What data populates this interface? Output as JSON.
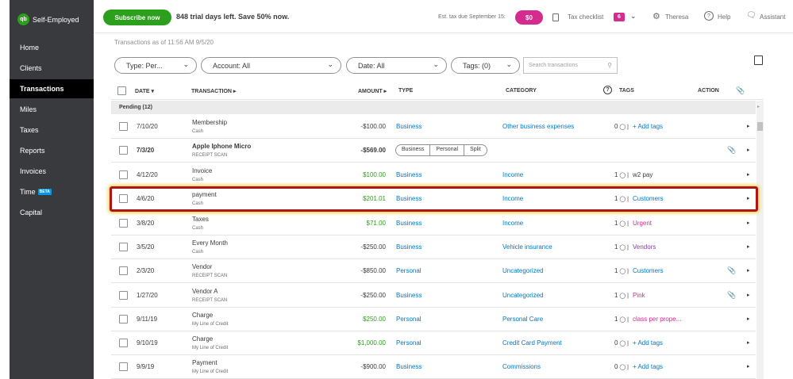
{
  "app": {
    "logo": "qb",
    "name": "Self-Employed"
  },
  "nav": [
    {
      "label": "Home"
    },
    {
      "label": "Clients"
    },
    {
      "label": "Transactions"
    },
    {
      "label": "Miles"
    },
    {
      "label": "Taxes"
    },
    {
      "label": "Reports"
    },
    {
      "label": "Invoices"
    },
    {
      "label": "Time",
      "badge": "BETA"
    },
    {
      "label": "Capital"
    }
  ],
  "topbar": {
    "subscribe": "Subscribe now",
    "trial": "848 trial days left. Save 50% now.",
    "est_tax": "Est. tax due September 15:",
    "tax_amount": "$0",
    "checklist": "Tax checklist",
    "checklist_count": "6",
    "user": "Theresa",
    "help": "Help",
    "assistant": "Assistant"
  },
  "as_of": "Transactions as of 11:56 AM 9/5/20",
  "filters": {
    "type": "Type: Per...",
    "account": "Account: All",
    "date": "Date: All",
    "tags": "Tags: (0)",
    "search_placeholder": "Search transactions"
  },
  "columns": {
    "date": "DATE",
    "transaction": "TRANSACTION",
    "amount": "AMOUNT",
    "type": "TYPE",
    "category": "CATEGORY",
    "tags": "TAGS",
    "action": "ACTION"
  },
  "pending_label": "Pending (12)",
  "split_options": [
    "Business",
    "Personal",
    "Split"
  ],
  "rows": [
    {
      "date": "7/10/20",
      "desc": "Membership",
      "sub": "Cash",
      "amount": "-$100.00",
      "type": "Business",
      "category": "Other business expenses",
      "tag_count": "0",
      "tag": "+ Add tags"
    },
    {
      "date": "7/3/20",
      "desc": "Apple Iphone Micro",
      "sub": "RECEIPT SCAN",
      "amount": "-$569.00",
      "type": "",
      "category": "",
      "tag_count": "",
      "tag": ""
    },
    {
      "date": "4/12/20",
      "desc": "Invoice",
      "sub": "Cash",
      "amount": "$100.00",
      "type": "Business",
      "category": "Income",
      "tag_count": "1",
      "tag": "w2 pay"
    },
    {
      "date": "4/6/20",
      "desc": "payment",
      "sub": "Cash",
      "amount": "$201.01",
      "type": "Business",
      "category": "Income",
      "tag_count": "1",
      "tag": "Customers"
    },
    {
      "date": "3/8/20",
      "desc": "Taxes",
      "sub": "Cash",
      "amount": "$71.00",
      "type": "Business",
      "category": "Income",
      "tag_count": "1",
      "tag": "Urgent"
    },
    {
      "date": "3/5/20",
      "desc": "Every Month",
      "sub": "Cash",
      "amount": "-$250.00",
      "type": "Business",
      "category": "Vehicle insurance",
      "tag_count": "1",
      "tag": "Vendors"
    },
    {
      "date": "2/3/20",
      "desc": "Vendor",
      "sub": "RECEIPT SCAN",
      "amount": "-$850.00",
      "type": "Personal",
      "category": "Uncategorized",
      "tag_count": "1",
      "tag": "Customers"
    },
    {
      "date": "1/27/20",
      "desc": "Vendor A",
      "sub": "RECEIPT SCAN",
      "amount": "-$250.00",
      "type": "Business",
      "category": "Uncategorized",
      "tag_count": "1",
      "tag": "Pink"
    },
    {
      "date": "9/11/19",
      "desc": "Charge",
      "sub": "My Line of Credit",
      "amount": "$250.00",
      "type": "Personal",
      "category": "Personal Care",
      "tag_count": "1",
      "tag": "class per prope..."
    },
    {
      "date": "9/10/19",
      "desc": "Charge",
      "sub": "My Line of Credit",
      "amount": "$1,000.00",
      "type": "Personal",
      "category": "Credit Card Payment",
      "tag_count": "0",
      "tag": "+ Add tags"
    },
    {
      "date": "9/9/19",
      "desc": "Payment",
      "sub": "My Line of Credit",
      "amount": "-$900.00",
      "type": "Business",
      "category": "Commissions",
      "tag_count": "0",
      "tag": "+ Add tags"
    }
  ],
  "colors": {
    "brand": "#2ca01c",
    "accent": "#d52b8f",
    "link": "#0077c5",
    "sidebar": "#393a3d",
    "highlight": "#b01414"
  }
}
